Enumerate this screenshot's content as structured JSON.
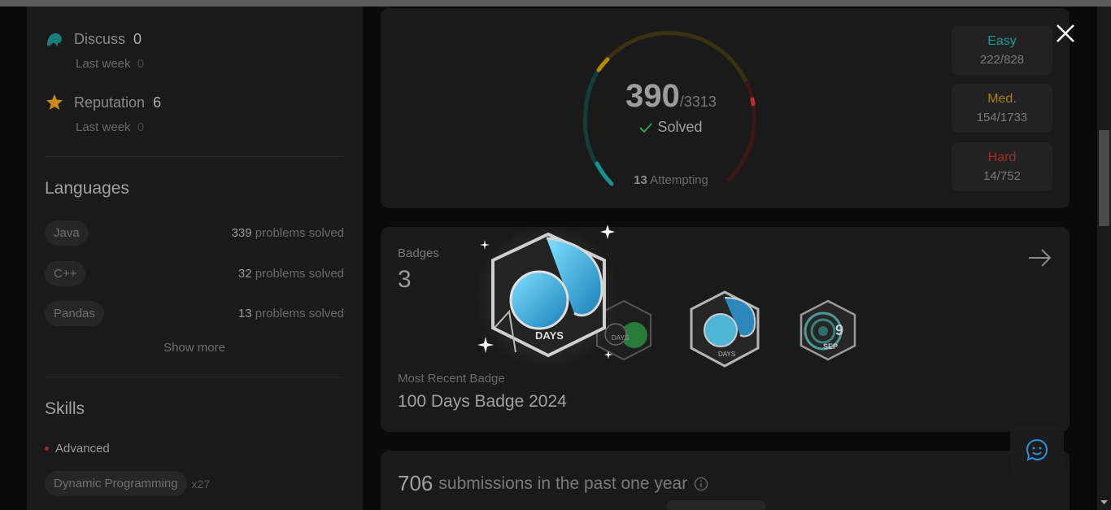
{
  "community": {
    "discuss": {
      "label": "Discuss",
      "value": "0",
      "week_label": "Last week",
      "week_value": "0"
    },
    "reputation": {
      "label": "Reputation",
      "value": "6",
      "week_label": "Last week",
      "week_value": "0"
    }
  },
  "languages": {
    "title": "Languages",
    "items": [
      {
        "name": "Java",
        "count": "339",
        "suffix": "problems solved"
      },
      {
        "name": "C++",
        "count": "32",
        "suffix": "problems solved"
      },
      {
        "name": "Pandas",
        "count": "13",
        "suffix": "problems solved"
      }
    ],
    "show_more": "Show more"
  },
  "skills": {
    "title": "Skills",
    "level": "Advanced",
    "first": {
      "name": "Dynamic Programming",
      "count": "x27"
    }
  },
  "progress": {
    "solved": "390",
    "total": "/3313",
    "solved_label": "Solved",
    "attempting_count": "13",
    "attempting_label": "Attempting",
    "easy": {
      "label": "Easy",
      "value": "222/828",
      "color": "#1cbaba"
    },
    "medium": {
      "label": "Med.",
      "value": "154/1733",
      "color": "#ffb700"
    },
    "hard": {
      "label": "Hard",
      "value": "14/752",
      "color": "#f63737"
    }
  },
  "badges": {
    "label": "Badges",
    "count": "3",
    "recent_label": "Most Recent Badge",
    "recent_name": "100 Days Badge 2024",
    "badge_text_days": "DAYS",
    "badge_text_month": "SEP",
    "badge_text_day": "9"
  },
  "submissions": {
    "count": "706",
    "text": "submissions in the past one year"
  },
  "icons": {
    "close": "close-icon",
    "chat": "chat-smile-icon",
    "arrow": "arrow-right-icon",
    "info": "info-icon"
  }
}
